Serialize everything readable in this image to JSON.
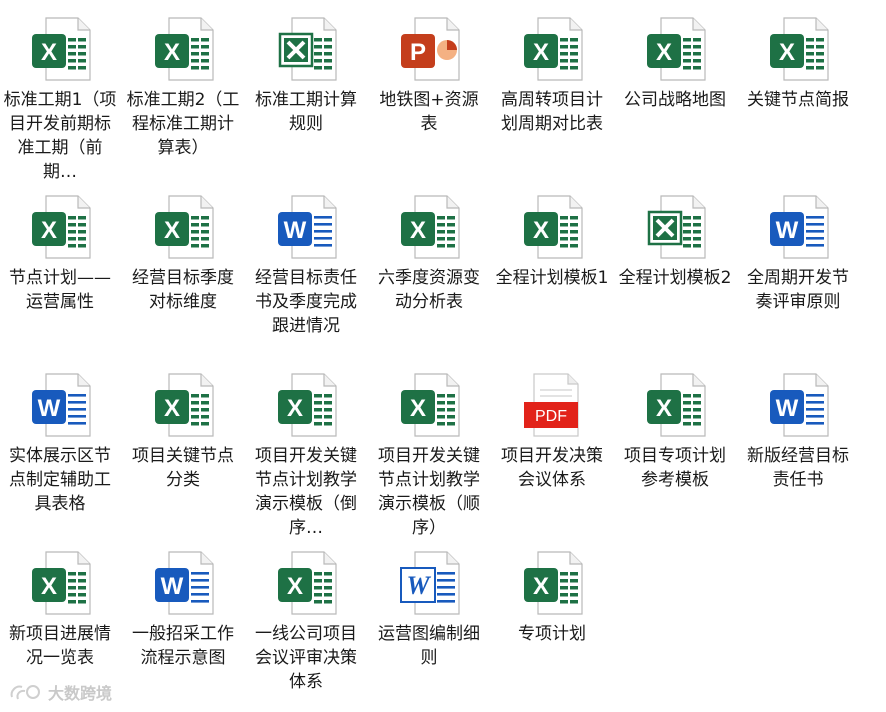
{
  "files": [
    {
      "name": "标准工期1（项目开发前期标准工期（前期…",
      "type": "xlsx"
    },
    {
      "name": "标准工期2（工程标准工期计算表）",
      "type": "xlsx"
    },
    {
      "name": "标准工期计算规则",
      "type": "xls"
    },
    {
      "name": "地铁图+资源表",
      "type": "pptx"
    },
    {
      "name": "高周转项目计划周期对比表",
      "type": "xlsx"
    },
    {
      "name": "公司战略地图",
      "type": "xlsx"
    },
    {
      "name": "关键节点简报",
      "type": "xlsx"
    },
    {
      "name": "节点计划——运营属性",
      "type": "xlsx"
    },
    {
      "name": "经营目标季度对标维度",
      "type": "xlsx"
    },
    {
      "name": "经营目标责任书及季度完成跟进情况",
      "type": "docx"
    },
    {
      "name": "六季度资源变动分析表",
      "type": "xlsx"
    },
    {
      "name": "全程计划模板1",
      "type": "xlsx"
    },
    {
      "name": "全程计划模板2",
      "type": "xls"
    },
    {
      "name": "全周期开发节奏评审原则",
      "type": "docx"
    },
    {
      "name": "实体展示区节点制定辅助工具表格",
      "type": "docx"
    },
    {
      "name": "项目关键节点分类",
      "type": "xlsx"
    },
    {
      "name": "项目开发关键节点计划教学演示模板（倒序…",
      "type": "xlsx"
    },
    {
      "name": "项目开发关键节点计划教学演示模板（顺序）",
      "type": "xlsx"
    },
    {
      "name": "项目开发决策会议体系",
      "type": "pdf"
    },
    {
      "name": "项目专项计划参考模板",
      "type": "xlsx"
    },
    {
      "name": "新版经营目标责任书",
      "type": "docx"
    },
    {
      "name": "新项目进展情况一览表",
      "type": "xlsx"
    },
    {
      "name": "一般招采工作流程示意图",
      "type": "docx"
    },
    {
      "name": "一线公司项目会议评审决策体系",
      "type": "xlsx"
    },
    {
      "name": "运营图编制细则",
      "type": "doc"
    },
    {
      "name": "专项计划",
      "type": "xlsx"
    }
  ],
  "watermark": {
    "text": "大数跨境"
  },
  "colors": {
    "excel": "#1e7145",
    "word": "#185abd",
    "powerpoint": "#c43e1c",
    "pdf": "#e2231a"
  }
}
